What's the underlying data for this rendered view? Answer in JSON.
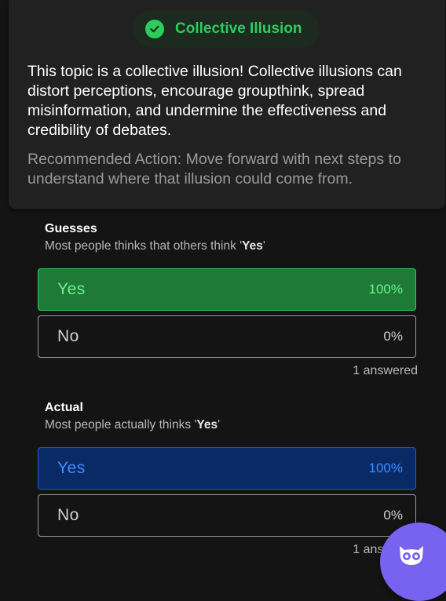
{
  "illusion_card": {
    "badge_label": "Collective Illusion",
    "description": "This topic is a collective illusion! Collective illusions can distort perceptions, encourage groupthink, spread misinformation, and undermine the effectiveness and credibility of debates.",
    "recommended_action": "Recommended Action: Move forward with next steps to understand where that illusion could come from."
  },
  "guesses": {
    "title": "Guesses",
    "subtitle_prefix": "Most people thinks that others think '",
    "subtitle_answer": "Yes",
    "subtitle_suffix": "'",
    "options": [
      {
        "label": "Yes",
        "percent": "100%"
      },
      {
        "label": "No",
        "percent": "0%"
      }
    ],
    "answered": "1 answered"
  },
  "actual": {
    "title": "Actual",
    "subtitle_prefix": "Most people actually thinks '",
    "subtitle_answer": "Yes",
    "subtitle_suffix": "'",
    "options": [
      {
        "label": "Yes",
        "percent": "100%"
      },
      {
        "label": "No",
        "percent": "0%"
      }
    ],
    "answered": "1 answered"
  },
  "colors": {
    "success_green": "#2ecc5c",
    "actual_blue": "#1d5bd6",
    "assistant_purple": "#7763f0"
  },
  "icons": {
    "badge": "check-circle-icon",
    "assistant": "owl-icon"
  }
}
